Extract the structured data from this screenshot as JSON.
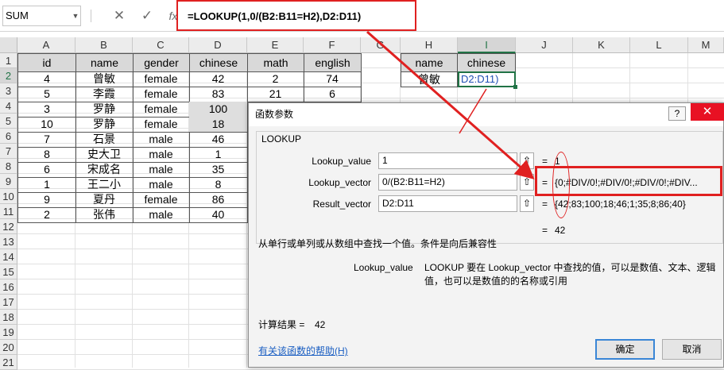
{
  "formula_bar": {
    "name_box": "SUM",
    "name_box_arrow": "▼",
    "cancel_icon": "✕",
    "enter_icon": "✓",
    "fx_icon": "fx",
    "formula": "=LOOKUP(1,0/(B2:B11=H2),D2:D11)"
  },
  "columns": [
    "A",
    "B",
    "C",
    "D",
    "E",
    "F",
    "G",
    "H",
    "I",
    "J",
    "K",
    "L",
    "M"
  ],
  "rows": [
    "1",
    "2",
    "3",
    "4",
    "5",
    "6",
    "7",
    "8",
    "9",
    "10",
    "11",
    "12",
    "13",
    "14",
    "15",
    "16",
    "17",
    "18",
    "19",
    "20",
    "21"
  ],
  "table": {
    "headers": [
      "id",
      "name",
      "gender",
      "chinese",
      "math",
      "english"
    ],
    "rows": [
      [
        "4",
        "曾敏",
        "female",
        "42",
        "2",
        "74"
      ],
      [
        "5",
        "李霞",
        "female",
        "83",
        "21",
        "6"
      ],
      [
        "3",
        "罗静",
        "female",
        "100",
        "",
        ""
      ],
      [
        "10",
        "罗静",
        "female",
        "18",
        "",
        ""
      ],
      [
        "7",
        "石景",
        "male",
        "46",
        "",
        ""
      ],
      [
        "8",
        "史大卫",
        "male",
        "1",
        "",
        ""
      ],
      [
        "6",
        "宋成名",
        "male",
        "35",
        "",
        ""
      ],
      [
        "1",
        "王二小",
        "male",
        "8",
        "",
        ""
      ],
      [
        "9",
        "夏丹",
        "female",
        "86",
        "",
        ""
      ],
      [
        "2",
        "张伟",
        "male",
        "40",
        "",
        ""
      ]
    ]
  },
  "lookup_table": {
    "headers": [
      "name",
      "chinese"
    ],
    "name_value": "曾敏",
    "edit_value": "D2:D11)"
  },
  "dialog": {
    "title": "函数参数",
    "help_button": "?",
    "close_button": "✕",
    "function_name": "LOOKUP",
    "args": [
      {
        "label": "Lookup_value",
        "value": "1",
        "result": "1"
      },
      {
        "label": "Lookup_vector",
        "value": "0/(B2:B11=H2)",
        "result": "{0;#DIV/0!;#DIV/0!;#DIV/0!;#DIV..."
      },
      {
        "label": "Result_vector",
        "value": "D2:D11",
        "result": "{42;83;100;18;46;1;35;8;86;40}"
      }
    ],
    "collapse_icon": "⇧",
    "equals": "=",
    "formula_result": "42",
    "description": "从单行或单列或从数组中查找一个值。条件是向后兼容性",
    "arg_help_label": "Lookup_value",
    "arg_help_text_1": "LOOKUP 要在 Lookup_vector 中查找的值，可以是数值、文本、逻辑",
    "arg_help_text_2": "值，也可以是数值的的名称或引用",
    "calc_result_label": "计算结果 =",
    "calc_result_value": "42",
    "help_link": "有关该函数的帮助(H)",
    "ok_button": "确定",
    "cancel_button": "取消"
  },
  "colors": {
    "excel_green": "#217346",
    "annotation_red": "#e02020",
    "header_gray": "#d9d9d9",
    "close_red": "#e81123"
  }
}
